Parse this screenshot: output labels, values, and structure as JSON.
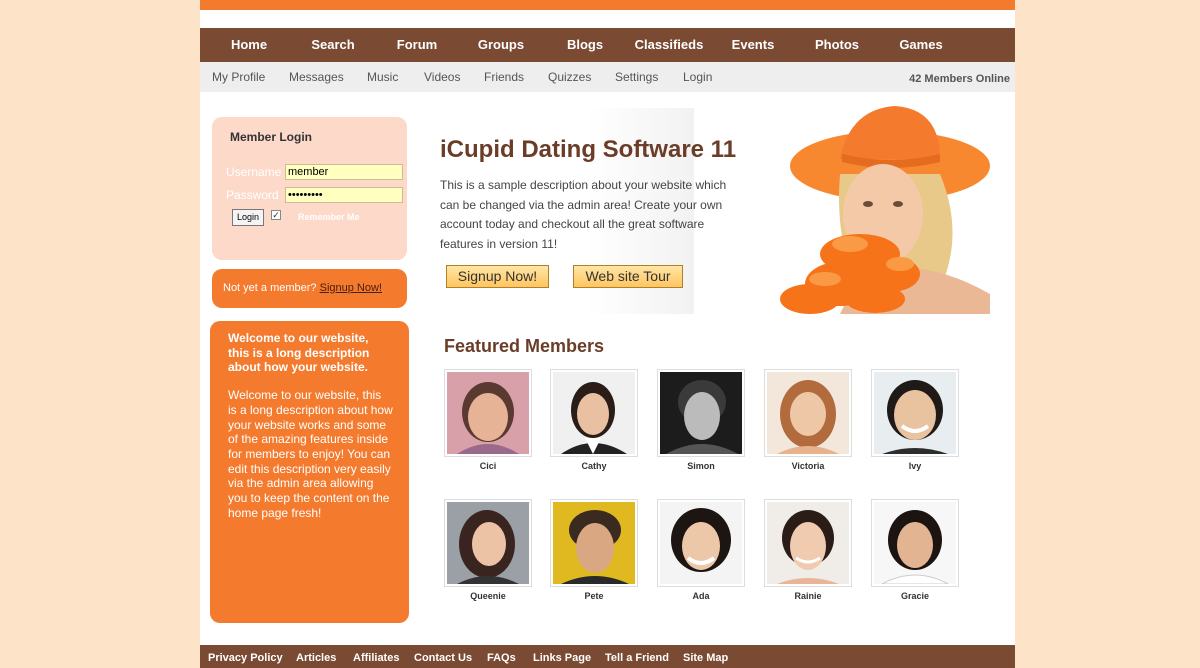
{
  "main_nav": [
    "Home",
    "Search",
    "Forum",
    "Groups",
    "Blogs",
    "Classifieds",
    "Events",
    "Photos",
    "Games"
  ],
  "sub_nav": [
    "My Profile",
    "Messages",
    "Music",
    "Videos",
    "Friends",
    "Quizzes",
    "Settings",
    "Login"
  ],
  "members_online": "42 Members Online",
  "login": {
    "title": "Member Login",
    "username_label": "Username",
    "username_value": "member",
    "password_label": "Password",
    "password_value": "•••••••••",
    "button": "Login",
    "remember": "Remember Me"
  },
  "signup": {
    "text": "Not yet a member?",
    "link": "Signup Now!"
  },
  "welcome": {
    "heading": "Welcome to our website, this is a long description about how your website.",
    "body": "Welcome to our website, this is a long description about how your website works and some of the amazing features inside for members to enjoy! You can edit this description very easily via the admin area allowing you to keep the content on the home page fresh!"
  },
  "hero": {
    "title": "iCupid Dating Software 11",
    "description": "This is a sample description about your website which can be changed via the admin area! Create your own account today and checkout all the great software features in version 11!",
    "signup_button": "Signup Now!",
    "tour_button": "Web site Tour"
  },
  "featured": {
    "title": "Featured Members",
    "members": [
      {
        "name": "Cici"
      },
      {
        "name": "Cathy"
      },
      {
        "name": "Simon"
      },
      {
        "name": "Victoria"
      },
      {
        "name": "Ivy"
      },
      {
        "name": "Queenie"
      },
      {
        "name": "Pete"
      },
      {
        "name": "Ada"
      },
      {
        "name": "Rainie"
      },
      {
        "name": "Gracie"
      }
    ]
  },
  "footer": [
    "Privacy Policy",
    "Articles",
    "Affiliates",
    "Contact Us",
    "FAQs",
    "Links Page",
    "Tell a Friend",
    "Site Map"
  ],
  "colors": {
    "accent": "#f47a2e",
    "nav": "#7a4a33",
    "title": "#6b3d28",
    "login_bg": "#fcd9c9",
    "page_bg": "#fde3c8"
  }
}
